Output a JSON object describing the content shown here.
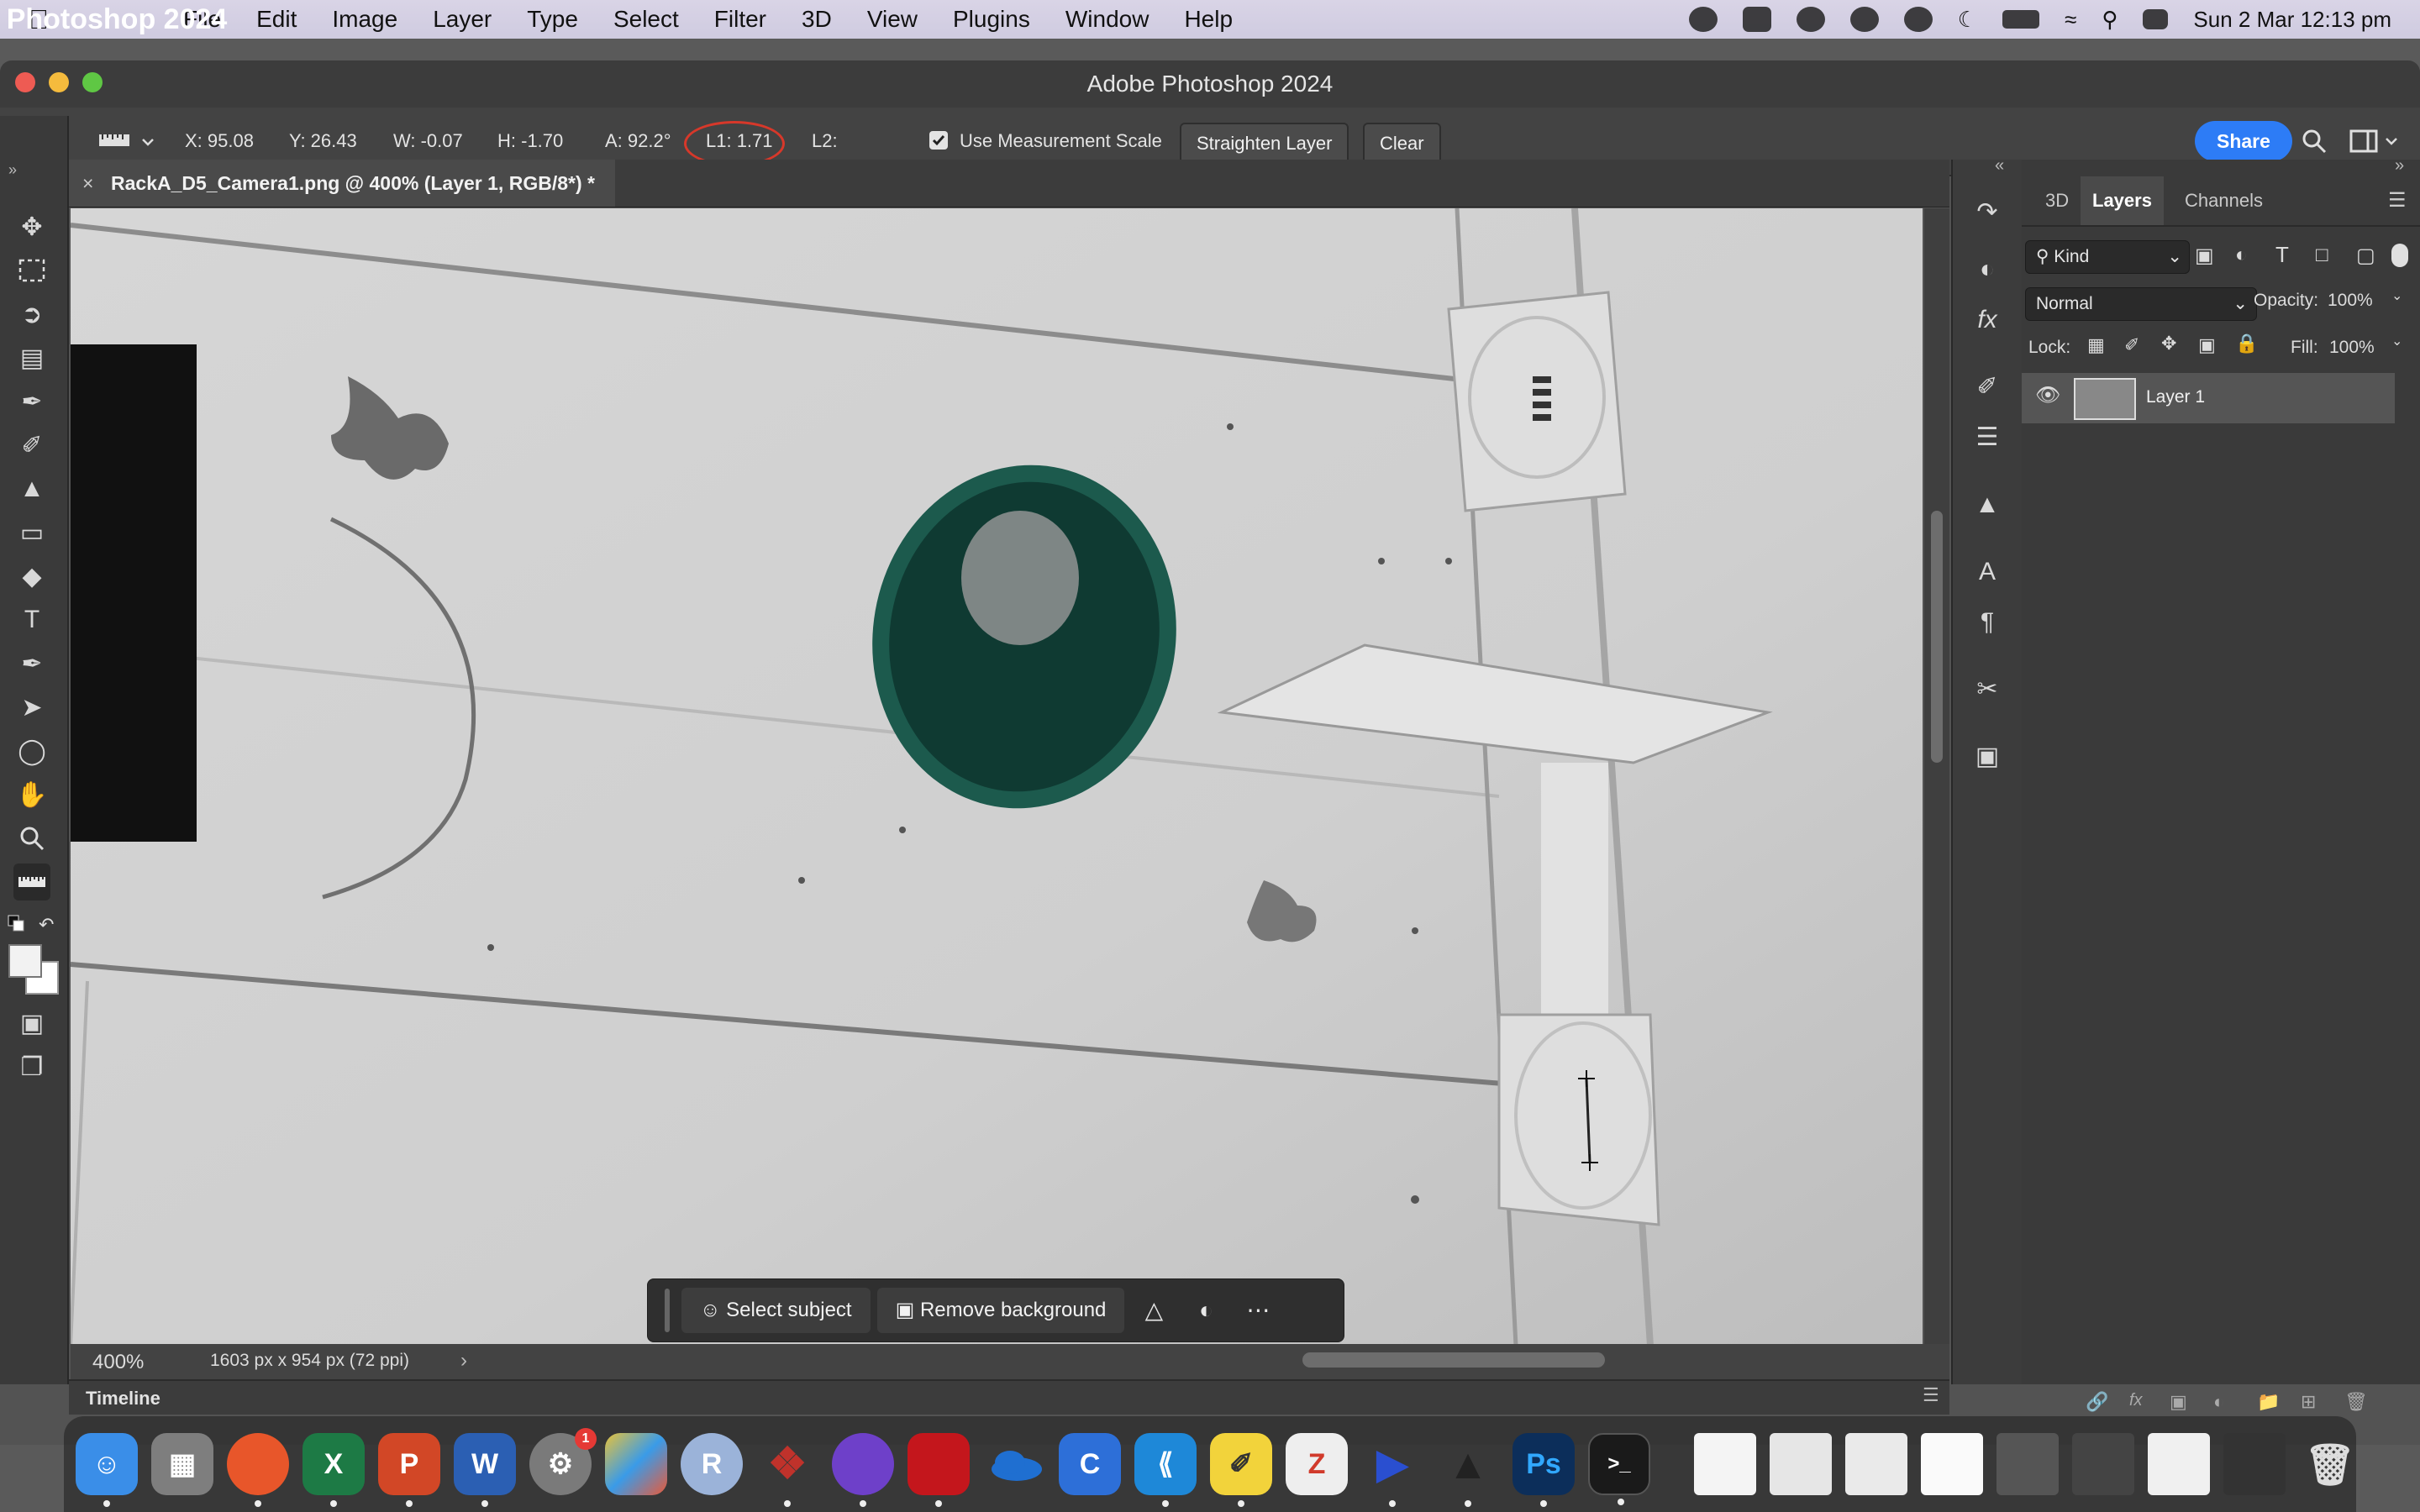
{
  "menubar": {
    "apple_icon": "apple-icon",
    "app_name": "Photoshop 2024",
    "items": [
      "File",
      "Edit",
      "Image",
      "Layer",
      "Type",
      "Select",
      "Filter",
      "3D",
      "View",
      "Plugins",
      "Window",
      "Help"
    ],
    "clock": "Sun 2 Mar  12:13 pm",
    "status_icons": [
      "creative-cloud-icon",
      "dropbox-icon",
      "vpn-icon",
      "notification-icon",
      "play-icon",
      "moon-icon",
      "battery-icon",
      "wifi-icon",
      "search-icon",
      "control-center-icon"
    ]
  },
  "window": {
    "title": "Adobe Photoshop 2024"
  },
  "options": {
    "tool_icon": "ruler-icon",
    "x": "X: 95.08",
    "y": "Y: 26.43",
    "w": "W: -0.07",
    "h": "H: -1.70",
    "a": "A: 92.2°",
    "l1": "L1: 1.71",
    "l2": "L2:",
    "measurement_scale_label": "Use Measurement Scale",
    "measurement_scale_checked": true,
    "straighten_label": "Straighten Layer",
    "clear_label": "Clear",
    "share_label": "Share"
  },
  "document": {
    "tab_title": "RackA_D5_Camera1.png @ 400% (Layer 1, RGB/8*) *",
    "zoom": "400%",
    "info": "1603 px x 954 px (72 ppi)"
  },
  "context_bar": {
    "select_subject": "Select subject",
    "remove_background": "Remove background"
  },
  "timeline": {
    "label": "Timeline"
  },
  "panels": {
    "tabs": [
      "3D",
      "Layers",
      "Channels"
    ],
    "active_tab": "Layers",
    "kind_filter": "Kind",
    "blend_mode": "Normal",
    "opacity_label": "Opacity:",
    "opacity_value": "100%",
    "lock_label": "Lock:",
    "fill_label": "Fill:",
    "fill_value": "100%",
    "layers": [
      {
        "name": "Layer 1",
        "visible": true
      }
    ]
  },
  "dock": {
    "apps": [
      {
        "name": "finder-icon",
        "color": "#3a8ee8",
        "running": true
      },
      {
        "name": "launchpad-icon",
        "color": "#e07b39",
        "running": false
      },
      {
        "name": "firefox-icon",
        "color": "#e8562a",
        "running": true
      },
      {
        "name": "excel-icon",
        "color": "#1d7a45",
        "running": true
      },
      {
        "name": "powerpoint-icon",
        "color": "#d24726",
        "running": true
      },
      {
        "name": "word-icon",
        "color": "#2b5fb3",
        "running": true
      },
      {
        "name": "system-settings-icon",
        "color": "#7a7a7a",
        "running": false,
        "badge": "1"
      },
      {
        "name": "app-icon-multicolor",
        "color": "#e8c23a",
        "running": false
      },
      {
        "name": "r-icon",
        "color": "#9bb3d9",
        "running": false
      },
      {
        "name": "dragon-app-icon",
        "color": "#c0322b",
        "running": true
      },
      {
        "name": "github-icon",
        "color": "#6e40c9",
        "running": true
      },
      {
        "name": "acrobat-icon",
        "color": "#c4161c",
        "running": true
      },
      {
        "name": "onedrive-icon",
        "color": "#1f6fd1",
        "running": false
      },
      {
        "name": "c-app-icon",
        "color": "#2d6fd8",
        "running": false
      },
      {
        "name": "vscode-icon",
        "color": "#1e88d8",
        "running": true
      },
      {
        "name": "notes-icon",
        "color": "#f2d33b",
        "running": true
      },
      {
        "name": "zotero-icon",
        "color": "#d13a2b",
        "running": false
      },
      {
        "name": "media-icon",
        "color": "#2a4fd0",
        "running": true
      },
      {
        "name": "inkscape-icon",
        "color": "#222222",
        "running": true
      },
      {
        "name": "photoshop-icon",
        "color": "#0c2e5a",
        "running": true
      },
      {
        "name": "terminal-icon",
        "color": "#1a1a1a",
        "running": true
      }
    ],
    "finder_letter": "",
    "photoshop_label": "Ps",
    "terminal_label": ">_",
    "r_label": "R",
    "excel_label": "X",
    "word_label": "W",
    "powerpoint_label": "P",
    "zotero_label": "Z"
  }
}
